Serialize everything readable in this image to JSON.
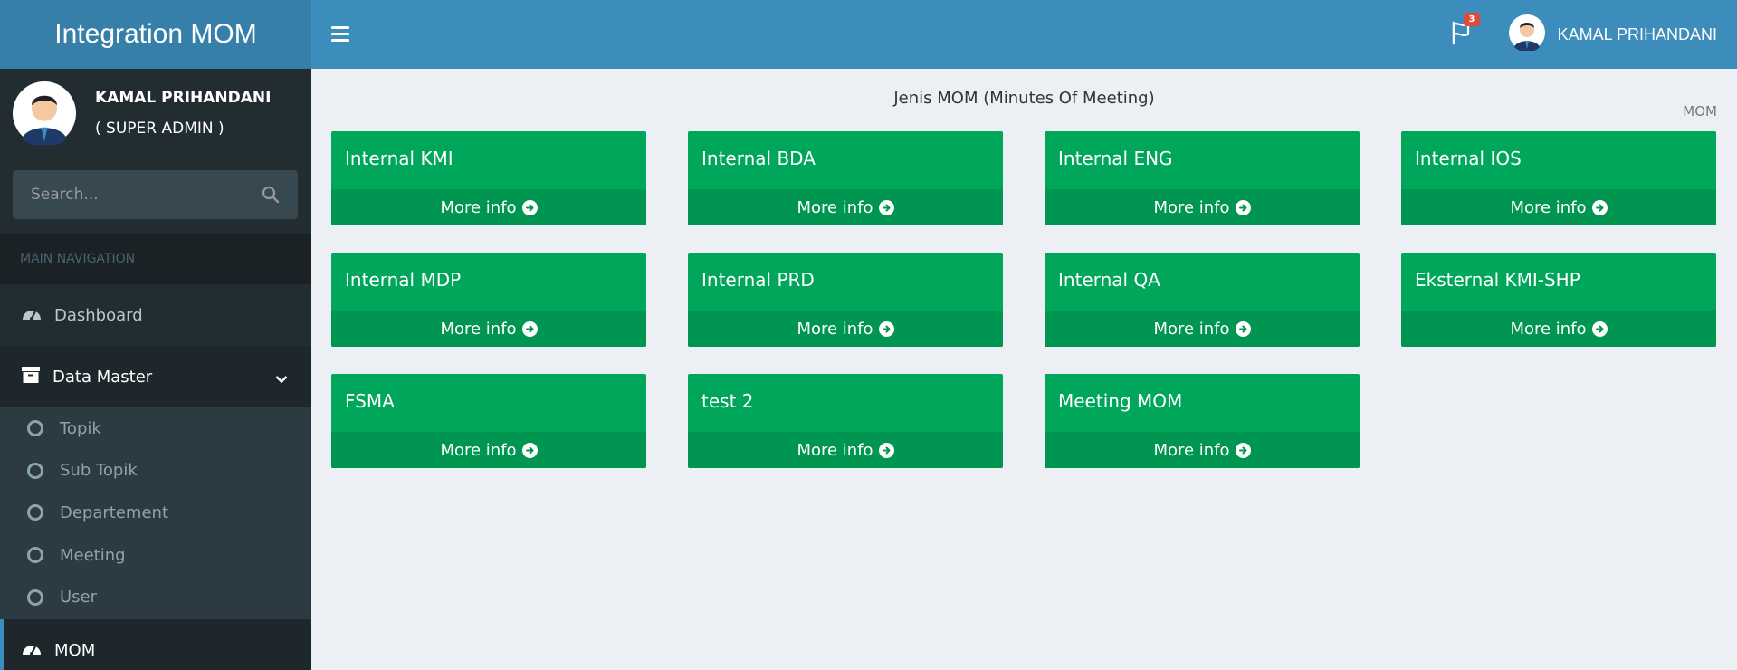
{
  "app": {
    "title": "Integration MOM"
  },
  "header": {
    "notification_count": "3",
    "user_name": "KAMAL PRIHANDANI"
  },
  "sidebar": {
    "user_name": "KAMAL PRIHANDANI",
    "user_role": "( SUPER ADMIN )",
    "search_placeholder": "Search...",
    "nav_header": "MAIN NAVIGATION",
    "dashboard_label": "Dashboard",
    "data_master_label": "Data Master",
    "sub_items": [
      "Topik",
      "Sub Topik",
      "Departement",
      "Meeting",
      "User"
    ],
    "mom_label": "MOM"
  },
  "main": {
    "title": "Jenis MOM (Minutes Of Meeting)",
    "breadcrumb": "MOM",
    "more_info_label": "More info",
    "cards": [
      {
        "title": "Internal KMI"
      },
      {
        "title": "Internal BDA"
      },
      {
        "title": "Internal ENG"
      },
      {
        "title": "Internal IOS"
      },
      {
        "title": "Internal MDP"
      },
      {
        "title": "Internal PRD"
      },
      {
        "title": "Internal QA"
      },
      {
        "title": "Eksternal KMI-SHP"
      },
      {
        "title": "FSMA"
      },
      {
        "title": "test 2"
      },
      {
        "title": "Meeting MOM"
      }
    ]
  },
  "colors": {
    "header": "#3c8dbc",
    "logo": "#367fa9",
    "sidebar": "#222d32",
    "card": "#00a65a",
    "card_footer": "#009551",
    "badge": "#dd4b39"
  },
  "icons": {
    "menu": "hamburger-icon",
    "notifications": "flag-icon",
    "search": "search-icon",
    "dashboard": "dashboard-icon",
    "data_master": "archive-icon",
    "submenu": "circle-icon",
    "more_info": "arrow-circle-right-icon"
  }
}
